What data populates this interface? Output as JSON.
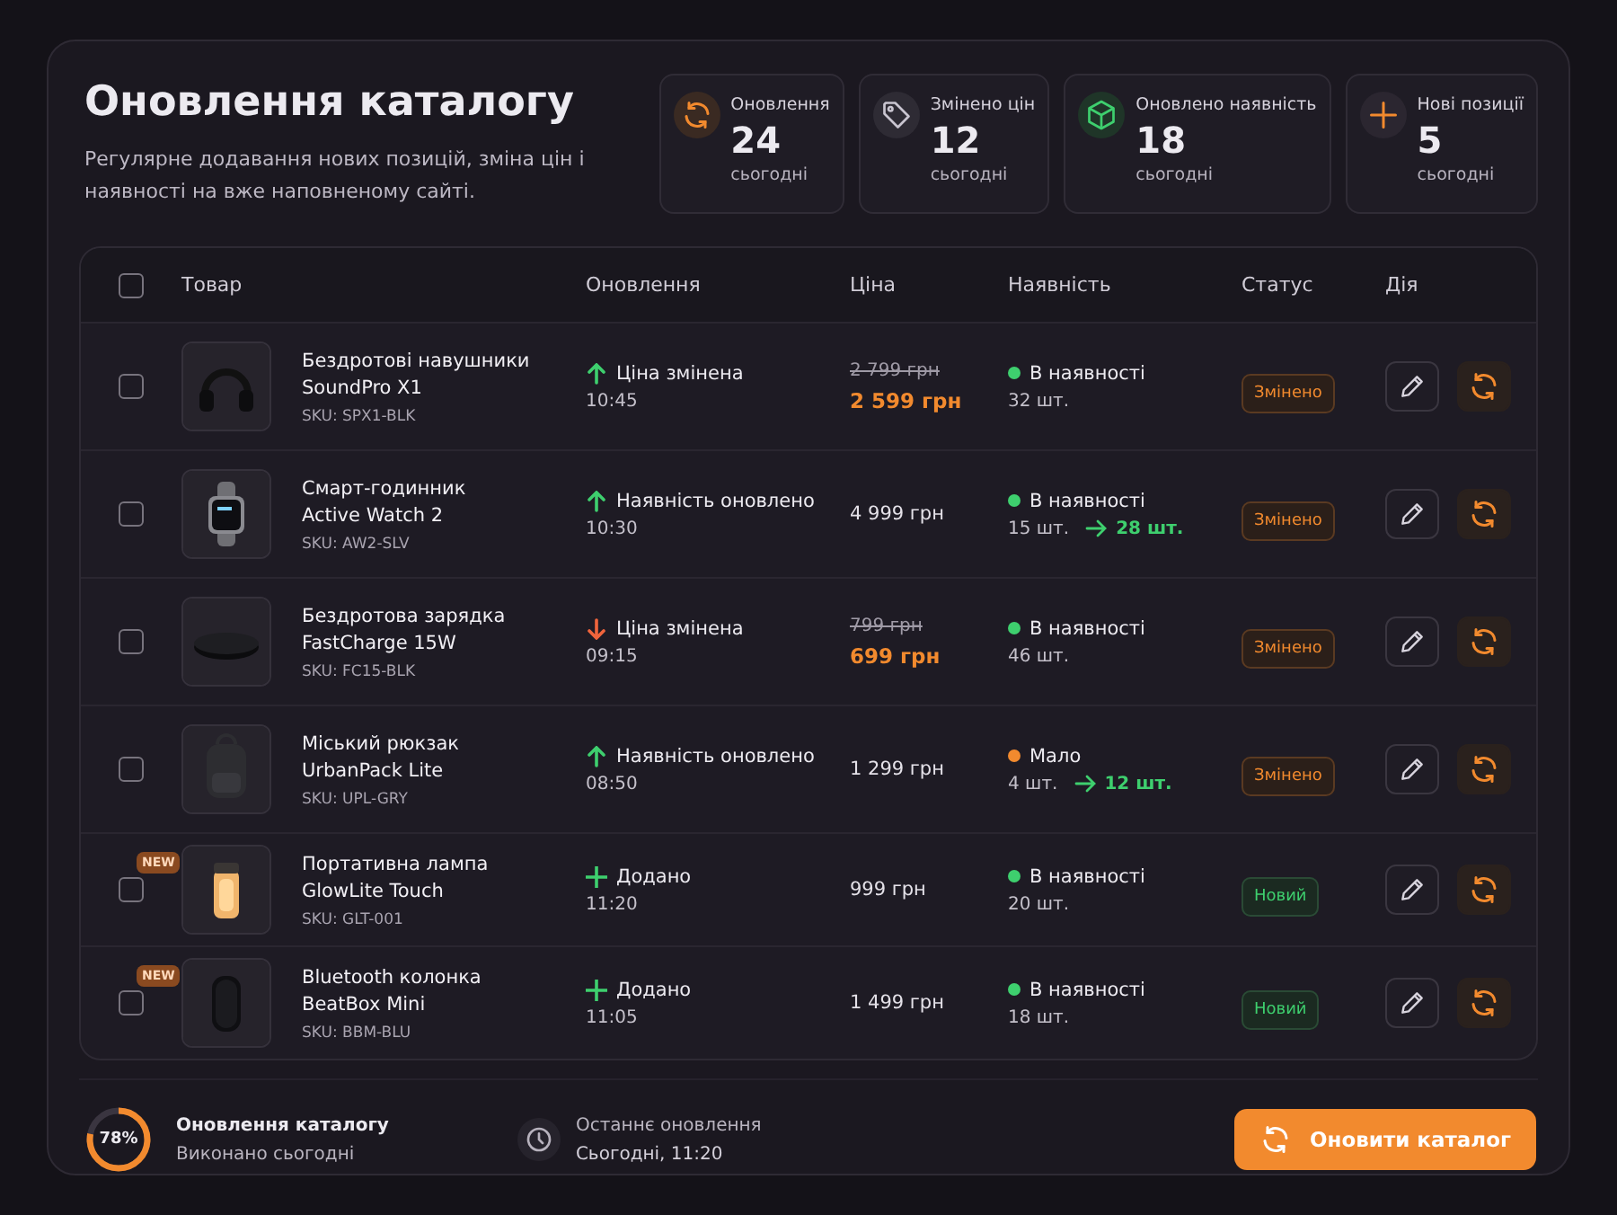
{
  "header": {
    "title": "Оновлення каталогу",
    "subtitle": "Регулярне додавання нових позицій, зміна цін і наявності на вже наповненому сайті."
  },
  "stats": [
    {
      "label": "Оновлення",
      "value": "24",
      "note": "сьогодні"
    },
    {
      "label": "Змінено цін",
      "value": "12",
      "note": "сьогодні"
    },
    {
      "label": "Оновлено наявність",
      "value": "18",
      "note": "сьогодні"
    },
    {
      "label": "Нові позиції",
      "value": "5",
      "note": "сьогодні"
    }
  ],
  "table": {
    "select_all": false,
    "columns": [
      "Товар",
      "Оновлення",
      "Ціна",
      "Наявність",
      "Статус",
      "Дія"
    ],
    "rows": [
      {
        "checked": false,
        "name": "Бездротові навушники",
        "model": "SoundPro X1",
        "sku": "SKU: SPX1-BLK",
        "update": {
          "kind": "up",
          "text": "Ціна змінена",
          "time": "10:45"
        },
        "price": {
          "old": "2 799 грн",
          "current": "2 599 грн"
        },
        "stock": {
          "status": "В наявності",
          "color": "#3ecf6e",
          "qty": "32 шт."
        },
        "status": {
          "kind": "changed",
          "text": "Змінено"
        }
      },
      {
        "checked": false,
        "name": "Смарт-годинник",
        "model": "Active Watch 2",
        "sku": "SKU: AW2-SLV",
        "update": {
          "kind": "up",
          "text": "Наявність оновлено",
          "time": "10:30"
        },
        "price": {
          "current": "4 999 грн"
        },
        "stock": {
          "status": "В наявності",
          "color": "#3ecf6e",
          "qty": "15 шт.",
          "qty_new": "28 шт."
        },
        "status": {
          "kind": "changed",
          "text": "Змінено"
        }
      },
      {
        "checked": false,
        "name": "Бездротова зарядка",
        "model": "FastCharge 15W",
        "sku": "SKU: FC15-BLK",
        "update": {
          "kind": "down",
          "text": "Ціна змінена",
          "time": "09:15"
        },
        "price": {
          "old": "799 грн",
          "current": "699 грн"
        },
        "stock": {
          "status": "В наявності",
          "color": "#3ecf6e",
          "qty": "46 шт."
        },
        "status": {
          "kind": "changed",
          "text": "Змінено"
        }
      },
      {
        "checked": false,
        "name": "Міський рюкзак",
        "model": "UrbanPack Lite",
        "sku": "SKU: UPL-GRY",
        "update": {
          "kind": "up",
          "text": "Наявність оновлено",
          "time": "08:50"
        },
        "price": {
          "current": "1 299 грн"
        },
        "stock": {
          "status": "Мало",
          "color": "#f28a2e",
          "qty": "4 шт.",
          "qty_new": "12 шт."
        },
        "status": {
          "kind": "changed",
          "text": "Змінено"
        }
      },
      {
        "checked": false,
        "badge": "NEW",
        "name": "Портативна лампа",
        "model": "GlowLite Touch",
        "sku": "SKU: GLT-001",
        "update": {
          "kind": "added",
          "text": "Додано",
          "time": "11:20"
        },
        "price": {
          "current": "999 грн"
        },
        "stock": {
          "status": "В наявності",
          "color": "#3ecf6e",
          "qty": "20 шт."
        },
        "status": {
          "kind": "new",
          "text": "Новий"
        }
      },
      {
        "checked": false,
        "badge": "NEW",
        "name": "Bluetooth колонка",
        "model": "BeatBox Mini",
        "sku": "SKU: BBM-BLU",
        "update": {
          "kind": "added",
          "text": "Додано",
          "time": "11:05"
        },
        "price": {
          "current": "1 499 грн"
        },
        "stock": {
          "status": "В наявності",
          "color": "#3ecf6e",
          "qty": "18 шт."
        },
        "status": {
          "kind": "new",
          "text": "Новий"
        }
      }
    ]
  },
  "footer": {
    "progress": {
      "level": 0.78,
      "label": "78%",
      "title": "Оновлення каталогу",
      "note": "Виконано сьогодні"
    },
    "last_update": {
      "label": "Останнє оновлення",
      "value": "Сьогодні, 11:20"
    },
    "button": "Оновити каталог"
  }
}
